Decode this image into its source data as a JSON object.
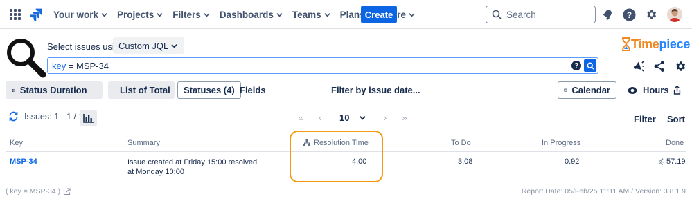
{
  "nav": {
    "items": [
      "Your work",
      "Projects",
      "Filters",
      "Dashboards",
      "Teams",
      "Plans",
      "More"
    ],
    "create_label": "Create",
    "search_placeholder": "Search"
  },
  "query": {
    "select_label": "Select issues using",
    "mode": "Custom JQL",
    "jql_field": "key",
    "jql_rest": " = MSP-34"
  },
  "brand": {
    "part1": "Time",
    "part2": "piece"
  },
  "toolbar": {
    "status_duration": "Status Duration",
    "list_of_total": "List of Total",
    "statuses": "Statuses (4)",
    "fields": "Fields",
    "filter_by_date": "Filter by issue date...",
    "calendar": "Calendar",
    "hours": "Hours"
  },
  "results": {
    "issues_count": "Issues: 1 - 1 / 1",
    "page_size": "10",
    "filter_label": "Filter",
    "sort_label": "Sort"
  },
  "table": {
    "headers": {
      "key": "Key",
      "summary": "Summary",
      "resolution_time": "Resolution Time",
      "to_do": "To Do",
      "in_progress": "In Progress",
      "done": "Done"
    },
    "rows": [
      {
        "key": "MSP-34",
        "summary": "Issue created at Friday 15:00 resolved at Monday 10:00",
        "resolution_time": "4.00",
        "to_do": "3.08",
        "in_progress": "0.92",
        "done": "57.19"
      }
    ]
  },
  "footer": {
    "query": "( key = MSP-34 )",
    "report": "Report Date: 05/Feb/25 11:11 AM / Version: 3.8.1.9"
  },
  "colors": {
    "primary": "#0c66e4",
    "highlight": "#f39c12",
    "brand_orange": "#f08a24",
    "brand_blue": "#2684ff"
  }
}
